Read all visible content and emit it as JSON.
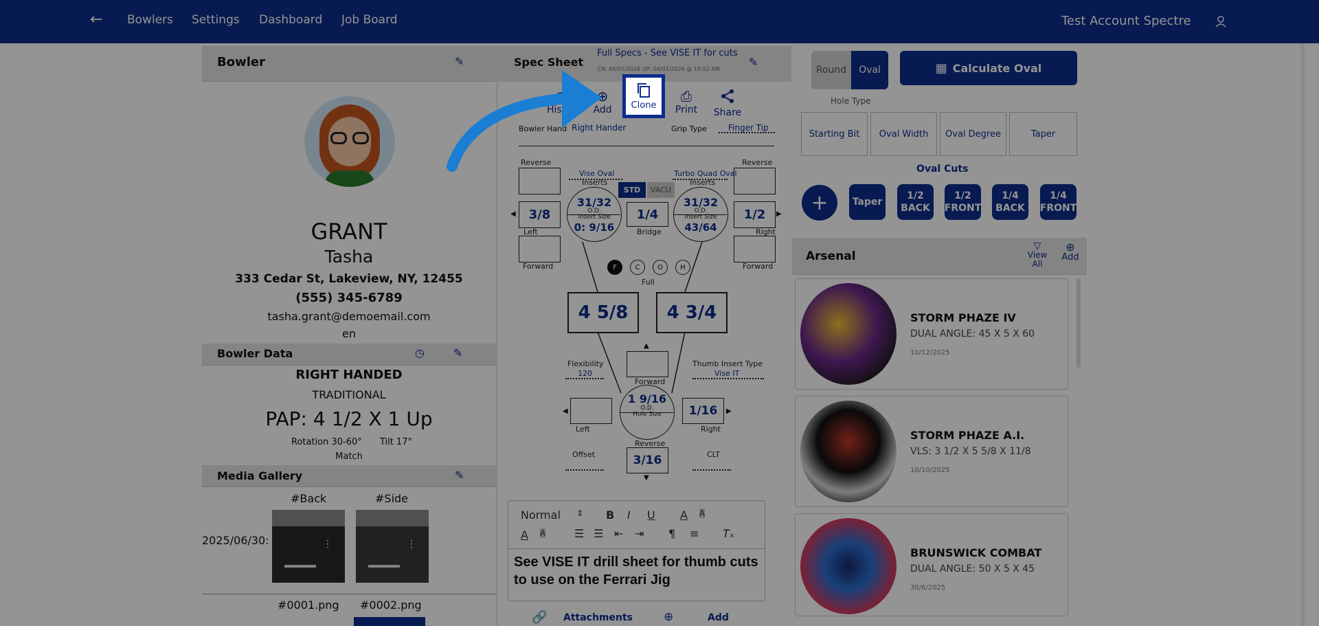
{
  "nav": {
    "items": [
      "Bowlers",
      "Settings",
      "Dashboard",
      "Job Board"
    ],
    "account": "Test Account Spectre"
  },
  "bowler": {
    "header": "Bowler",
    "last_name": "GRANT",
    "first_name": "Tasha",
    "address": "333 Cedar St, Lakeview, NY, 12455",
    "phone": "(555) 345-6789",
    "email": "tasha.grant@demoemail.com",
    "lang": "en"
  },
  "bowler_data": {
    "header": "Bowler Data",
    "hand": "RIGHT HANDED",
    "style": "TRADITIONAL",
    "pap": "PAP: 4 1/2 X 1 Up",
    "rotation": "Rotation 30-60°",
    "tilt": "Tilt 17°",
    "match": "Match"
  },
  "media": {
    "header": "Media Gallery",
    "tag_back": "#Back",
    "tag_side": "#Side",
    "date": "2025/06/30:",
    "file1": "#0001.png",
    "file2": "#0002.png"
  },
  "spec": {
    "header": "Spec Sheet",
    "full_specs": "Full Specs - See VISE IT for cuts",
    "created": "CR: 04/01/2026 UP: 04/01/2026 @ 10:52 AM",
    "actions": {
      "history": "History",
      "add": "Add",
      "clone": "Clone",
      "print": "Print",
      "share": "Share"
    },
    "bowler_hand_label": "Bowler Hand",
    "bowler_hand": "Right Hander",
    "grip_type_label": "Grip Type",
    "grip_type": "Finger Tip",
    "reverse": "Reverse",
    "forward": "Forward",
    "left": "Left",
    "right": "Right",
    "left_insert_type": "Vise Oval",
    "right_insert_type": "Turbo Quad Oval",
    "inserts": "Inserts",
    "std": "STD",
    "vacu": "VACU",
    "left_od": "31/32",
    "right_od": "31/32",
    "od": "O.D.",
    "insert_size": "Insert Size",
    "left_insert": "0: 9/16",
    "right_insert": "43/64",
    "left_lateral": "3/8",
    "right_lateral": "1/2",
    "bridge": "1/4",
    "bridge_label": "Bridge",
    "grips": [
      "F",
      "C",
      "O",
      "H"
    ],
    "full": "Full",
    "left_span": "4 5/8",
    "right_span": "4 3/4",
    "flexibility_label": "Flexibility",
    "flexibility": "120",
    "thumb_insert_label": "Thumb Insert Type",
    "thumb_insert": "Vise IT",
    "thumb_od": "1 9/16",
    "hole_size": "Hole Size",
    "thumb_right": "1/16",
    "thumb_reverse": "3/16",
    "offset": "Offset",
    "clt": "CLT",
    "editor_style": "Normal",
    "note": "See VISE IT drill sheet for thumb cuts to use on the Ferrari Jig",
    "attachments": "Attachments",
    "attach_add": "Add"
  },
  "oval": {
    "round": "Round",
    "oval": "Oval",
    "calc": "Calculate Oval",
    "hole_type": "Hole Type",
    "cells": [
      "Starting Bit",
      "Oval Width",
      "Oval Degree",
      "Taper"
    ],
    "cuts_title": "Oval Cuts",
    "cuts": [
      [
        "Taper"
      ],
      [
        "1/2",
        "BACK"
      ],
      [
        "1/2",
        "FRONT"
      ],
      [
        "1/4",
        "BACK"
      ],
      [
        "1/4",
        "FRONT"
      ]
    ]
  },
  "arsenal": {
    "header": "Arsenal",
    "view_all": "View All",
    "add": "Add",
    "balls": [
      {
        "name": "STORM PHAZE IV",
        "layout": "DUAL ANGLE: 45 X 5 X 60",
        "date": "10/12/2025",
        "colors": [
          "#f1c232",
          "#6b2a8a",
          "#1a1a1a"
        ]
      },
      {
        "name": "STORM PHAZE A.I.",
        "layout": "VLS: 3 1/2 X 5 5/8 X 11/8",
        "date": "10/10/2025",
        "colors": [
          "#111111",
          "#d9d9d9",
          "#c0392b"
        ]
      },
      {
        "name": "BRUNSWICK COMBAT",
        "layout": "DUAL ANGLE: 50 X 5 X 45",
        "date": "30/6/2025",
        "colors": [
          "#2c6fd1",
          "#d33a5a",
          "#1a2a6c"
        ]
      }
    ]
  }
}
